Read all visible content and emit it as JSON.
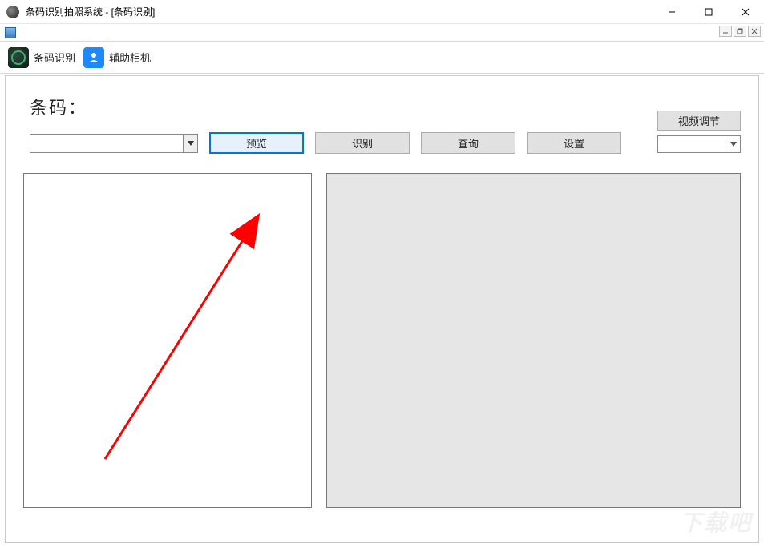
{
  "window": {
    "title": "条码识别拍照系统 - [条码识别]"
  },
  "toolbar": {
    "barcode_label": "条码识别",
    "camera_label": "辅助相机"
  },
  "main": {
    "heading": "条码：",
    "combo_value": "",
    "buttons": {
      "preview": "预览",
      "recognize": "识别",
      "query": "查询",
      "settings": "设置"
    },
    "right": {
      "video_adjust": "视频调节",
      "dropdown_value": ""
    }
  },
  "watermark": "下载吧"
}
